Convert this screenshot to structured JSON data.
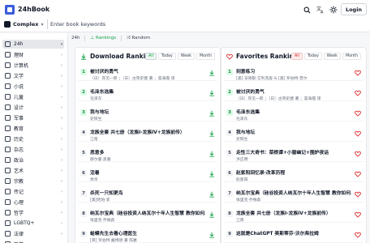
{
  "app": {
    "name": "24hBook"
  },
  "search": {
    "category": "Complex",
    "placeholder": "Enter book keywords"
  },
  "header": {
    "login_label": "Login"
  },
  "subnav": {
    "items": [
      "24h",
      "Rankings",
      "Random"
    ]
  },
  "sidebar": {
    "items": [
      {
        "label": "24h"
      },
      {
        "label": "理财"
      },
      {
        "label": "计算机"
      },
      {
        "label": "文学"
      },
      {
        "label": "小说"
      },
      {
        "label": "儿童"
      },
      {
        "label": "设计"
      },
      {
        "label": "军事"
      },
      {
        "label": "教育"
      },
      {
        "label": "历史"
      },
      {
        "label": "杂志"
      },
      {
        "label": "政治"
      },
      {
        "label": "艺术"
      },
      {
        "label": "宗教"
      },
      {
        "label": "传记"
      },
      {
        "label": "心理"
      },
      {
        "label": "哲学"
      },
      {
        "label": "LGBTQ+"
      },
      {
        "label": "法律"
      },
      {
        "label": "医学"
      }
    ]
  },
  "download_ranking": {
    "title": "Download Ranking",
    "filters": [
      "All",
      "Today",
      "Week",
      "Month"
    ],
    "active_filter": "All",
    "rows": [
      {
        "rank": "1",
        "title": "被讨厌的勇气",
        "sub": "（日）岸见一郎 ；（日）古贺史健 著 ；渠海霞 译"
      },
      {
        "rank": "2",
        "title": "毛泽东选集",
        "sub": "毛泽东"
      },
      {
        "rank": "3",
        "title": "我与地坛",
        "sub": "史铁生"
      },
      {
        "rank": "4",
        "title": "龙族全套 共七册（龙族I-龙族IV+龙族前传）",
        "sub": "江南"
      },
      {
        "rank": "5",
        "title": "恶意多",
        "sub": "赫尔曼·黑塞"
      },
      {
        "rank": "6",
        "title": "活着",
        "sub": "余华"
      },
      {
        "rank": "7",
        "title": "杀死一只知更鸟",
        "sub": "[美]哈珀·李"
      },
      {
        "rank": "8",
        "title": "纳瓦尔宝典（硅谷投资人纳瓦尔十年人生智慧 教你如何…",
        "sub": "埃里克·乔根森"
      },
      {
        "rank": "9",
        "title": "蛤蟆先生去看心理医生",
        "sub": "[英] 罗伯特·戴博德 著 陈赢"
      }
    ]
  },
  "favorites_ranking": {
    "title": "Favorites Ranking",
    "filters": [
      "All",
      "Today",
      "Week",
      "Month"
    ],
    "active_filter": "All",
    "rows": [
      {
        "rank": "1",
        "title": "刻意练习",
        "sub": "[美] 安德斯·艾利克森 & [美] 罗伯特·普尔"
      },
      {
        "rank": "2",
        "title": "被讨厌的勇气",
        "sub": "（日）岸见一郎 ；（日）古贺史健 著 ；渠海霞 译"
      },
      {
        "rank": "3",
        "title": "毛泽东选集",
        "sub": "毛泽东"
      },
      {
        "rank": "4",
        "title": "我与地坛",
        "sub": "史铁生"
      },
      {
        "rank": "5",
        "title": "走性三大奇书：菜根谭+小窗幽记+围炉夜话",
        "sub": "洪应明"
      },
      {
        "rank": "6",
        "title": "赵紫阳回忆录·改革历程",
        "sub": "赵紫阳"
      },
      {
        "rank": "7",
        "title": "纳瓦尔宝典（硅谷投资人纳瓦尔十年人生智慧 教你如何…",
        "sub": "埃里克·乔根森"
      },
      {
        "rank": "8",
        "title": "龙族全套 共七册（龙族I-龙族IV+龙族前传）",
        "sub": "江南"
      },
      {
        "rank": "9",
        "title": "这就是ChatGPT 美斯蒂芬·沃尔弗拉姆",
        "sub": ""
      }
    ]
  },
  "colors": {
    "brand": "#3b5bdb",
    "green": "#16a34a",
    "red": "#dc2626"
  }
}
